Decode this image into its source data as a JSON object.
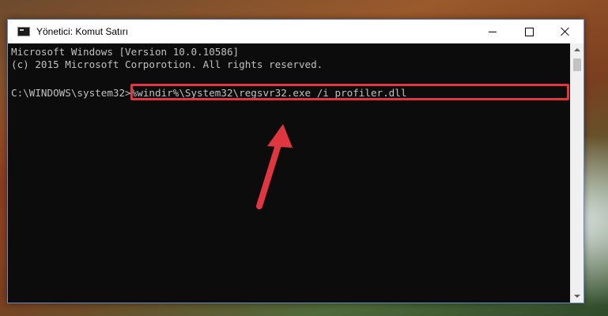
{
  "window": {
    "title": "Yönetici: Komut Satırı",
    "icon": "cmd-icon"
  },
  "controls": {
    "minimize": "minimize-icon",
    "maximize": "maximize-icon",
    "close": "close-icon"
  },
  "console": {
    "lines": [
      "Microsoft Windows [Version 10.0.10586]",
      "(c) 2015 Microsoft Corporotion. All rights reserved."
    ],
    "prompt": "C:\\WINDOWS\\system32>",
    "command": "%windir%\\System32\\regsvr32.exe /i profiler.dll"
  },
  "colors": {
    "console_bg": "#0c0c0c",
    "console_text": "#c0c0c0",
    "highlight": "#e0363f",
    "arrow": "#e0363f"
  }
}
